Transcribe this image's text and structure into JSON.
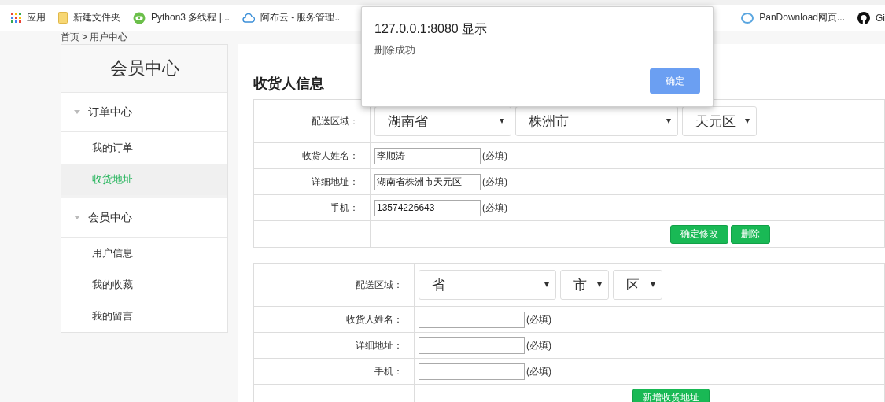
{
  "bookmarks": [
    {
      "kind": "apps",
      "label": "应用"
    },
    {
      "kind": "folder",
      "label": "新建文件夹"
    },
    {
      "kind": "site-green",
      "label": "Python3 多线程 |..."
    },
    {
      "kind": "cloud",
      "label": "阿布云 - 服务管理.."
    },
    {
      "kind": "cloud-blue",
      "label": "PanDownload网页..."
    },
    {
      "kind": "github",
      "label": "Gi"
    }
  ],
  "breadcrumb": {
    "home": "首页",
    "separator": ">",
    "current": "用户中心"
  },
  "sidebar": {
    "title": "会员中心",
    "groups": [
      {
        "label": "订单中心",
        "expanded": true,
        "items": [
          {
            "label": "我的订单",
            "selected": false
          },
          {
            "label": "收货地址",
            "selected": true
          }
        ]
      },
      {
        "label": "会员中心",
        "expanded": true,
        "items": [
          {
            "label": "用户信息",
            "selected": false
          },
          {
            "label": "我的收藏",
            "selected": false
          },
          {
            "label": "我的留言",
            "selected": false
          }
        ]
      }
    ]
  },
  "main": {
    "title": "收货人信息",
    "forms": [
      {
        "rows": [
          {
            "kind": "region",
            "label": "配送区域：",
            "selects": [
              "湖南省",
              "株洲市",
              "天元区"
            ]
          },
          {
            "kind": "text",
            "label": "收货人姓名：",
            "value": "李顺涛",
            "note": "(必填)"
          },
          {
            "kind": "text",
            "label": "详细地址：",
            "value": "湖南省株洲市天元区",
            "note": "(必填)"
          },
          {
            "kind": "text",
            "label": "手机：",
            "value": "13574226643",
            "note": "(必填)"
          }
        ],
        "buttons": [
          "确定修改",
          "删除"
        ]
      },
      {
        "rows": [
          {
            "kind": "region",
            "label": "配送区域：",
            "selects": [
              "省",
              "市",
              "区"
            ]
          },
          {
            "kind": "text",
            "label": "收货人姓名：",
            "note": "(必填)"
          },
          {
            "kind": "text",
            "label": "详细地址：",
            "note": "(必填)"
          },
          {
            "kind": "text",
            "label": "手机：",
            "note": "(必填)"
          }
        ],
        "buttons": [
          "新增收货地址"
        ]
      }
    ]
  },
  "dialog": {
    "title": "127.0.0.1:8080 显示",
    "message": "删除成功",
    "button": "确定"
  }
}
